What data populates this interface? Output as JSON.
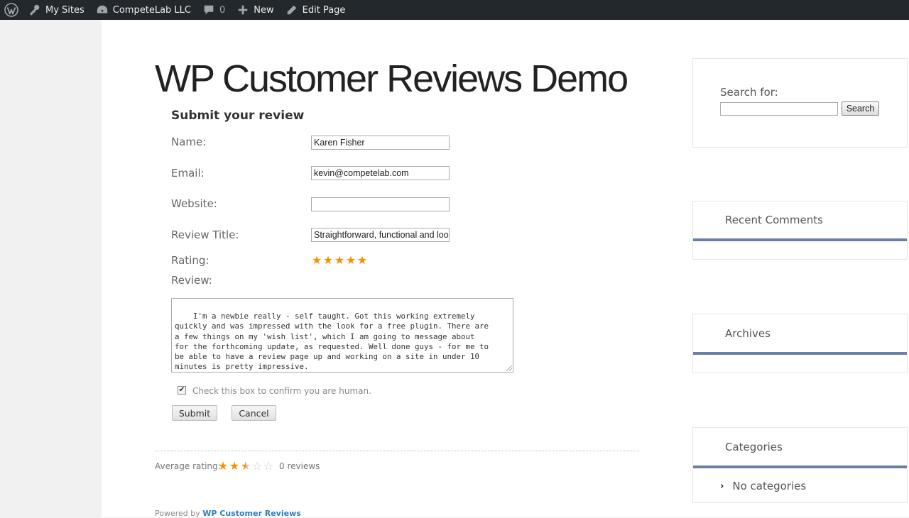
{
  "adminbar": {
    "items": [
      {
        "label": ""
      },
      {
        "label": "My Sites"
      },
      {
        "label": "CompeteLab LLC"
      },
      {
        "label": "0"
      },
      {
        "label": "New"
      },
      {
        "label": "Edit Page"
      }
    ]
  },
  "site": {
    "title": "WP Customer Reviews Demo"
  },
  "form": {
    "heading": "Submit your review",
    "name_label": "Name:",
    "name_value": "Karen Fisher",
    "email_label": "Email:",
    "email_value": "kevin@competelab.com",
    "website_label": "Website:",
    "website_value": "",
    "title_label": "Review Title:",
    "title_value": "Straightforward, functional and lool",
    "rating_label": "Rating:",
    "rating_value": 5,
    "rating_max": 5,
    "review_label": "Review:",
    "review_text": "I'm a newbie really - self taught. Got this working extremely\nquickly and was impressed with the look for a free plugin. There are\na few things on my 'wish list', which I am going to message about\nfor the forthcoming update, as requested. Well done guys - for me to\nbe able to have a review page up and working on a site in under 10\nminutes is pretty impressive.",
    "human_check_label": "Check this box to confirm you are human.",
    "human_checked": true,
    "submit_label": "Submit",
    "cancel_label": "Cancel"
  },
  "summary": {
    "avg_label": "Average rating:",
    "avg_rating": 2.5,
    "reviews_label": "0 reviews"
  },
  "footer": {
    "powered_prefix": "Powered by",
    "powered_link": "WP Customer Reviews"
  },
  "sidebar": {
    "search_label": "Search for:",
    "search_button": "Search",
    "recent_comments_title": "Recent Comments",
    "archives_title": "Archives",
    "categories_title": "Categories",
    "no_categories": "No categories"
  },
  "colors": {
    "adminbar_bg": "#23282d",
    "star_on": "#f39200",
    "widget_bar": "#6c7fa5",
    "link": "#2a7fc1"
  }
}
